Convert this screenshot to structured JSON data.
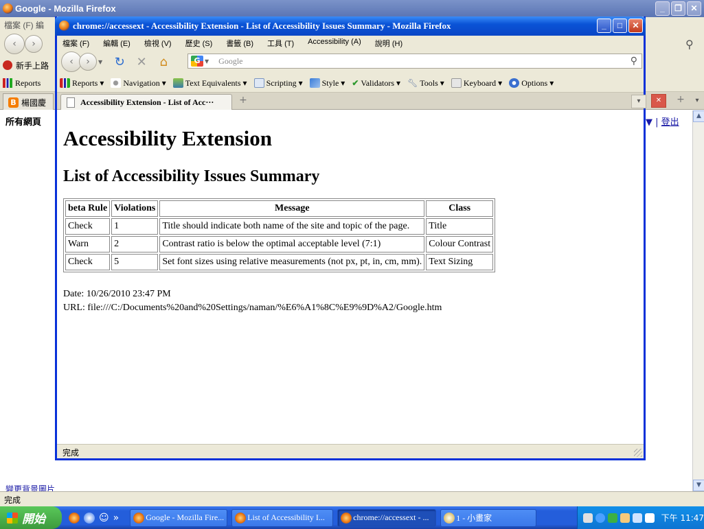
{
  "bg_window": {
    "title": "Google - Mozilla Firefox",
    "menu_partial": "檔案 (F)   編",
    "bookmark_first": "新手上路",
    "toolbar_reports": "Reports",
    "tab_label": "楊國慶",
    "content_label": "所有網頁",
    "link_signout": "登出",
    "link_bottom": "變更背景圖片",
    "status": "完成"
  },
  "window": {
    "title": "chrome://accessext - Accessibility Extension - List of Accessibility Issues Summary - Mozilla Firefox",
    "menu": [
      "檔案 (F)",
      "編輯 (E)",
      "檢視 (V)",
      "歷史 (S)",
      "書籤 (B)",
      "工具 (T)",
      "Accessibility (A)",
      "說明 (H)"
    ],
    "search_placeholder": "Google",
    "extensions": [
      "Reports",
      "Navigation",
      "Text Equivalents",
      "Scripting",
      "Style",
      "Validators",
      "Tools",
      "Keyboard",
      "Options"
    ],
    "tab_title": "Accessibility Extension - List of Acc···",
    "status": "完成"
  },
  "page": {
    "h1": "Accessibility Extension",
    "h2": "List of Accessibility Issues Summary",
    "table": {
      "headers": [
        "beta Rule",
        "Violations",
        "Message",
        "Class"
      ],
      "rows": [
        [
          "Check",
          "1",
          "Title should indicate both name of the site and topic of the page.",
          "Title"
        ],
        [
          "Warn",
          "2",
          "Contrast ratio is below the optimal acceptable level (7:1)",
          "Colour Contrast"
        ],
        [
          "Check",
          "5",
          "Set font sizes using relative measurements (not px, pt, in, cm, mm).",
          "Text Sizing"
        ]
      ]
    },
    "date": "Date: 10/26/2010 23:47 PM",
    "url": "URL: file:///C:/Documents%20and%20Settings/naman/%E6%A1%8C%E9%9D%A2/Google.htm"
  },
  "taskbar": {
    "start": "開始",
    "tasks": [
      "Google - Mozilla Fire...",
      "List of Accessibility I...",
      "chrome://accessext - ...",
      "1 - 小畫家"
    ],
    "clock": "下午 11:47"
  }
}
